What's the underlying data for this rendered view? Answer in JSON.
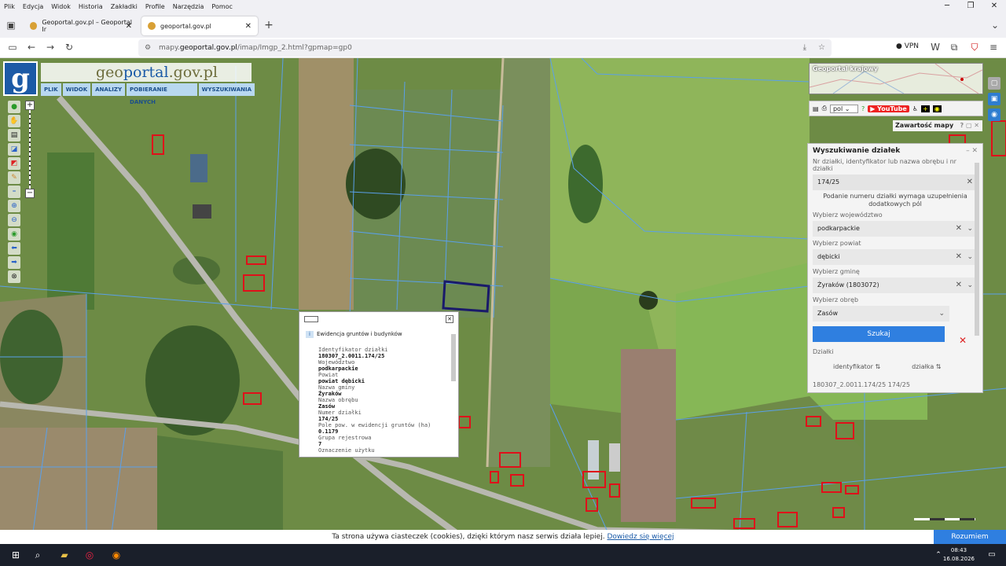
{
  "browser": {
    "menu": [
      "Plik",
      "Edycja",
      "Widok",
      "Historia",
      "Zakładki",
      "Profile",
      "Narzędzia",
      "Pomoc"
    ],
    "tabs": [
      {
        "title": "Geoportal.gov.pl – Geoportal Ir"
      },
      {
        "title": "geoportal.gov.pl"
      }
    ],
    "url_prefix": "mapy.",
    "url_domain": "geoportal.gov.pl",
    "url_path": "/imap/Imgp_2.html?gpmap=gp0",
    "vpn_label": "VPN"
  },
  "app": {
    "logo_letter": "g",
    "logo_text_1": "geo",
    "logo_text_2": "portal",
    "logo_text_3": ".gov.pl",
    "menu": [
      "PLIK",
      "WIDOK",
      "ANALIZY",
      "POBIERANIE DANYCH",
      "WYSZUKIWANIA"
    ],
    "overview_label": "Geoportal krajowy",
    "lang": "pol",
    "youtube": "YouTube",
    "content_label": "Zawartość mapy"
  },
  "search": {
    "title": "Wyszukiwanie działek",
    "field_label": "Nr działki, identyfikator lub nazwa obrębu i nr działki",
    "field_value": "174/25",
    "note": "Podanie numeru działki wymaga uzupełnienia dodatkowych pól",
    "voiv_label": "Wybierz województwo",
    "voiv_value": "podkarpackie",
    "pow_label": "Wybierz powiat",
    "pow_value": "dębicki",
    "gmina_label": "Wybierz gminę",
    "gmina_value": "Żyraków (1803072)",
    "obreb_label": "Wybierz obręb",
    "obreb_value": "Zasów",
    "search_button": "Szukaj",
    "results_label": "Działki",
    "col_id": "identyfikator",
    "col_dz": "działka",
    "row_preview": "180307_2.0011.174/25        174/25"
  },
  "popup": {
    "source": "Ewidencja gruntów i budynków",
    "fields": [
      {
        "k": "Identyfikator działki",
        "v": "180307_2.0011.174/25"
      },
      {
        "k": "Województwo",
        "v": "podkarpackie"
      },
      {
        "k": "Powiat",
        "v": "powiat dębicki"
      },
      {
        "k": "Nazwa gminy",
        "v": "Żyraków"
      },
      {
        "k": "Nazwa obrębu",
        "v": "Zasów"
      },
      {
        "k": "Numer działki",
        "v": "174/25"
      },
      {
        "k": "Pole pow. w ewidencji gruntów (ha)",
        "v": "0.1179"
      },
      {
        "k": "Grupa rejestrowa",
        "v": "7"
      },
      {
        "k": "Oznaczenie użytku",
        "v": ""
      }
    ]
  },
  "cookie": {
    "text": "Ta strona używa ciasteczek (cookies), dzięki którym nasz serwis działa lepiej.",
    "link": "Dowiedz się więcej",
    "button": "Rozumiem"
  },
  "taskbar": {
    "time": "08:43",
    "date": "16.08.2026"
  }
}
